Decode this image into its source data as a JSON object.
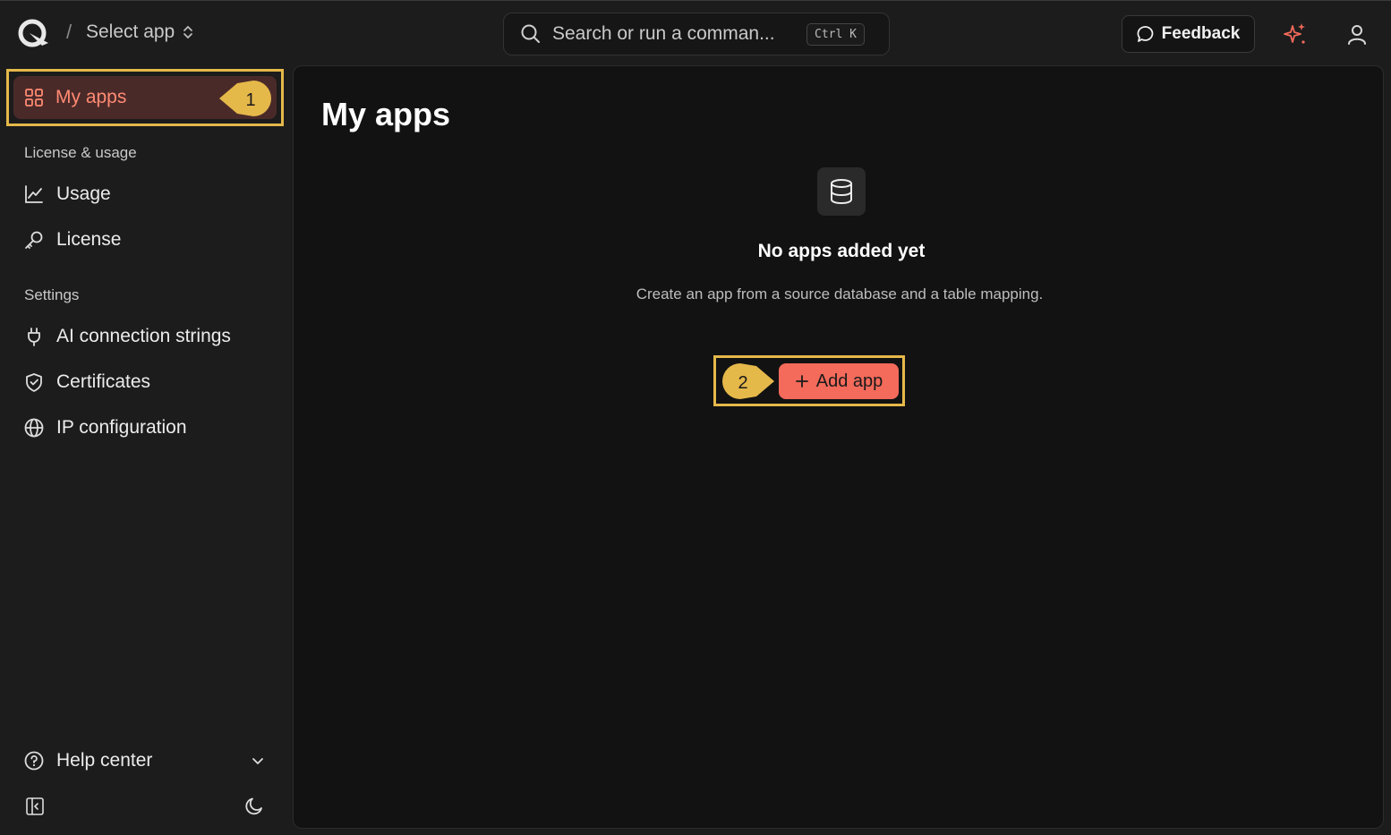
{
  "topbar": {
    "breadcrumb_separator": "/",
    "select_app_label": "Select app",
    "search_placeholder": "Search or run a comman...",
    "search_shortcut": "Ctrl K",
    "feedback_label": "Feedback"
  },
  "sidebar": {
    "active_item": {
      "label": "My apps",
      "icon": "grid-icon",
      "callout": "1"
    },
    "sections": [
      {
        "label": "License & usage",
        "items": [
          {
            "label": "Usage",
            "icon": "chart-line-icon"
          },
          {
            "label": "License",
            "icon": "key-icon"
          }
        ]
      },
      {
        "label": "Settings",
        "items": [
          {
            "label": "AI connection strings",
            "icon": "plug-icon"
          },
          {
            "label": "Certificates",
            "icon": "shield-icon"
          },
          {
            "label": "IP configuration",
            "icon": "globe-icon"
          }
        ]
      }
    ],
    "help_label": "Help center"
  },
  "main": {
    "title": "My apps",
    "empty_title": "No apps added yet",
    "empty_subtitle": "Create an app from a source database and a table mapping.",
    "add_button_label": "Add app",
    "callout": "2"
  },
  "colors": {
    "accent": "#f46a5b",
    "active_bg": "#4a2a29",
    "highlight": "#e5b84a"
  }
}
